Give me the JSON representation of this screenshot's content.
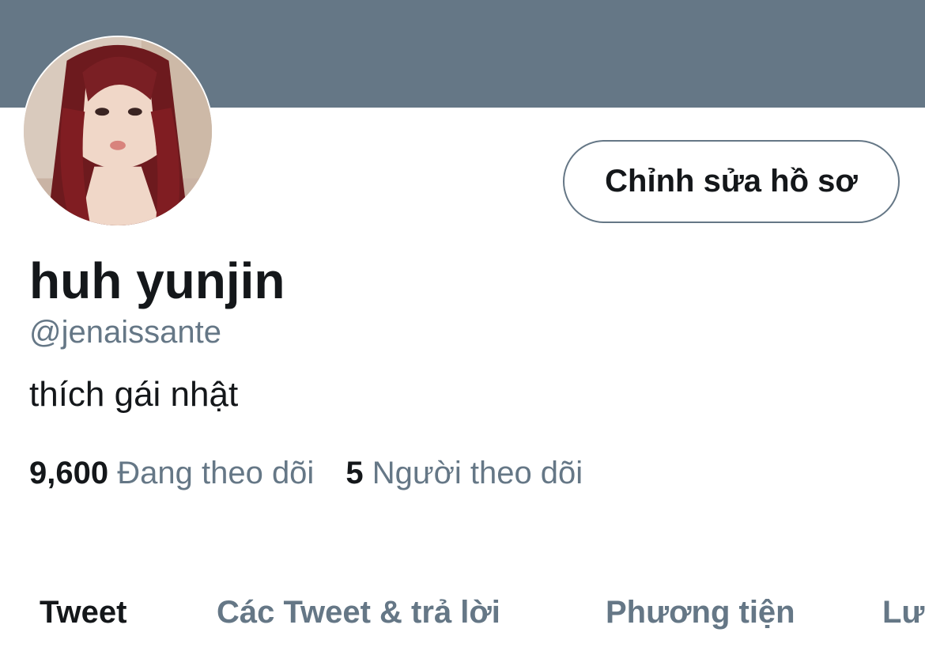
{
  "profile": {
    "display_name": "huh yunjin",
    "handle": "@jenaissante",
    "bio": "thích gái nhật",
    "edit_button_label": "Chỉnh sửa hồ sơ",
    "following_count": "9,600",
    "following_label": "Đang theo dõi",
    "followers_count": "5",
    "followers_label": "Người theo dõi"
  },
  "tabs": [
    {
      "label": "Tweet",
      "active": true
    },
    {
      "label": "Các Tweet & trả lời",
      "active": false
    },
    {
      "label": "Phương tiện",
      "active": false
    },
    {
      "label": "Lư",
      "active": false
    }
  ],
  "colors": {
    "banner": "#657786",
    "primary_text": "#14171a",
    "secondary_text": "#657786",
    "background": "#ffffff"
  }
}
